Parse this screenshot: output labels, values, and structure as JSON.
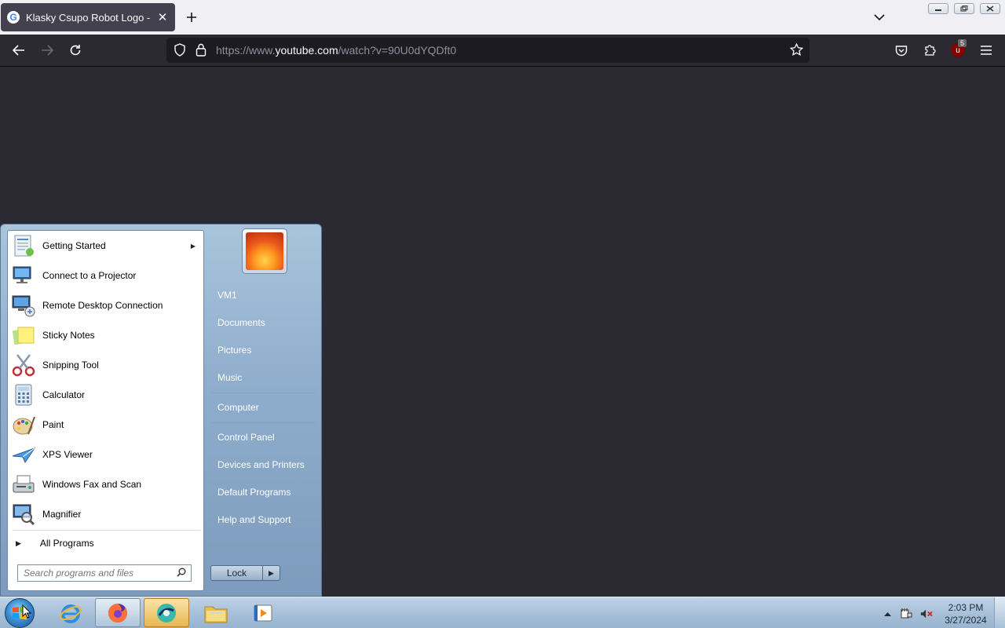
{
  "browser": {
    "tab_title": "Klasky Csupo Robot Logo - You",
    "favicon_letter": "G",
    "new_tab_icon": "plus-icon",
    "url_scheme_prefix": "https://www.",
    "url_domain": "youtube.com",
    "url_path": "/watch?v=90U0dYQDft0",
    "extension_badge": "5",
    "extension_letter": "u"
  },
  "start_menu": {
    "programs": [
      {
        "label": "Getting Started",
        "icon": "getting-started-icon",
        "has_submenu": true
      },
      {
        "label": "Connect to a Projector",
        "icon": "projector-icon"
      },
      {
        "label": "Remote Desktop Connection",
        "icon": "remote-desktop-icon"
      },
      {
        "label": "Sticky Notes",
        "icon": "sticky-notes-icon"
      },
      {
        "label": "Snipping Tool",
        "icon": "scissors-icon"
      },
      {
        "label": "Calculator",
        "icon": "calculator-icon"
      },
      {
        "label": "Paint",
        "icon": "paint-palette-icon"
      },
      {
        "label": "XPS Viewer",
        "icon": "xps-viewer-icon"
      },
      {
        "label": "Windows Fax and Scan",
        "icon": "fax-icon"
      },
      {
        "label": "Magnifier",
        "icon": "magnifier-icon"
      }
    ],
    "all_programs_label": "All Programs",
    "search_placeholder": "Search programs and files",
    "places": [
      "VM1",
      "Documents",
      "Pictures",
      "Music",
      "Computer",
      "Control Panel",
      "Devices and Printers",
      "Default Programs",
      "Help and Support"
    ],
    "lock_label": "Lock"
  },
  "taskbar": {
    "apps": [
      "internet-explorer-icon",
      "firefox-icon",
      "remote-app-icon",
      "file-explorer-icon",
      "media-player-icon"
    ],
    "clock_time": "2:03 PM",
    "clock_date": "3/27/2024"
  }
}
